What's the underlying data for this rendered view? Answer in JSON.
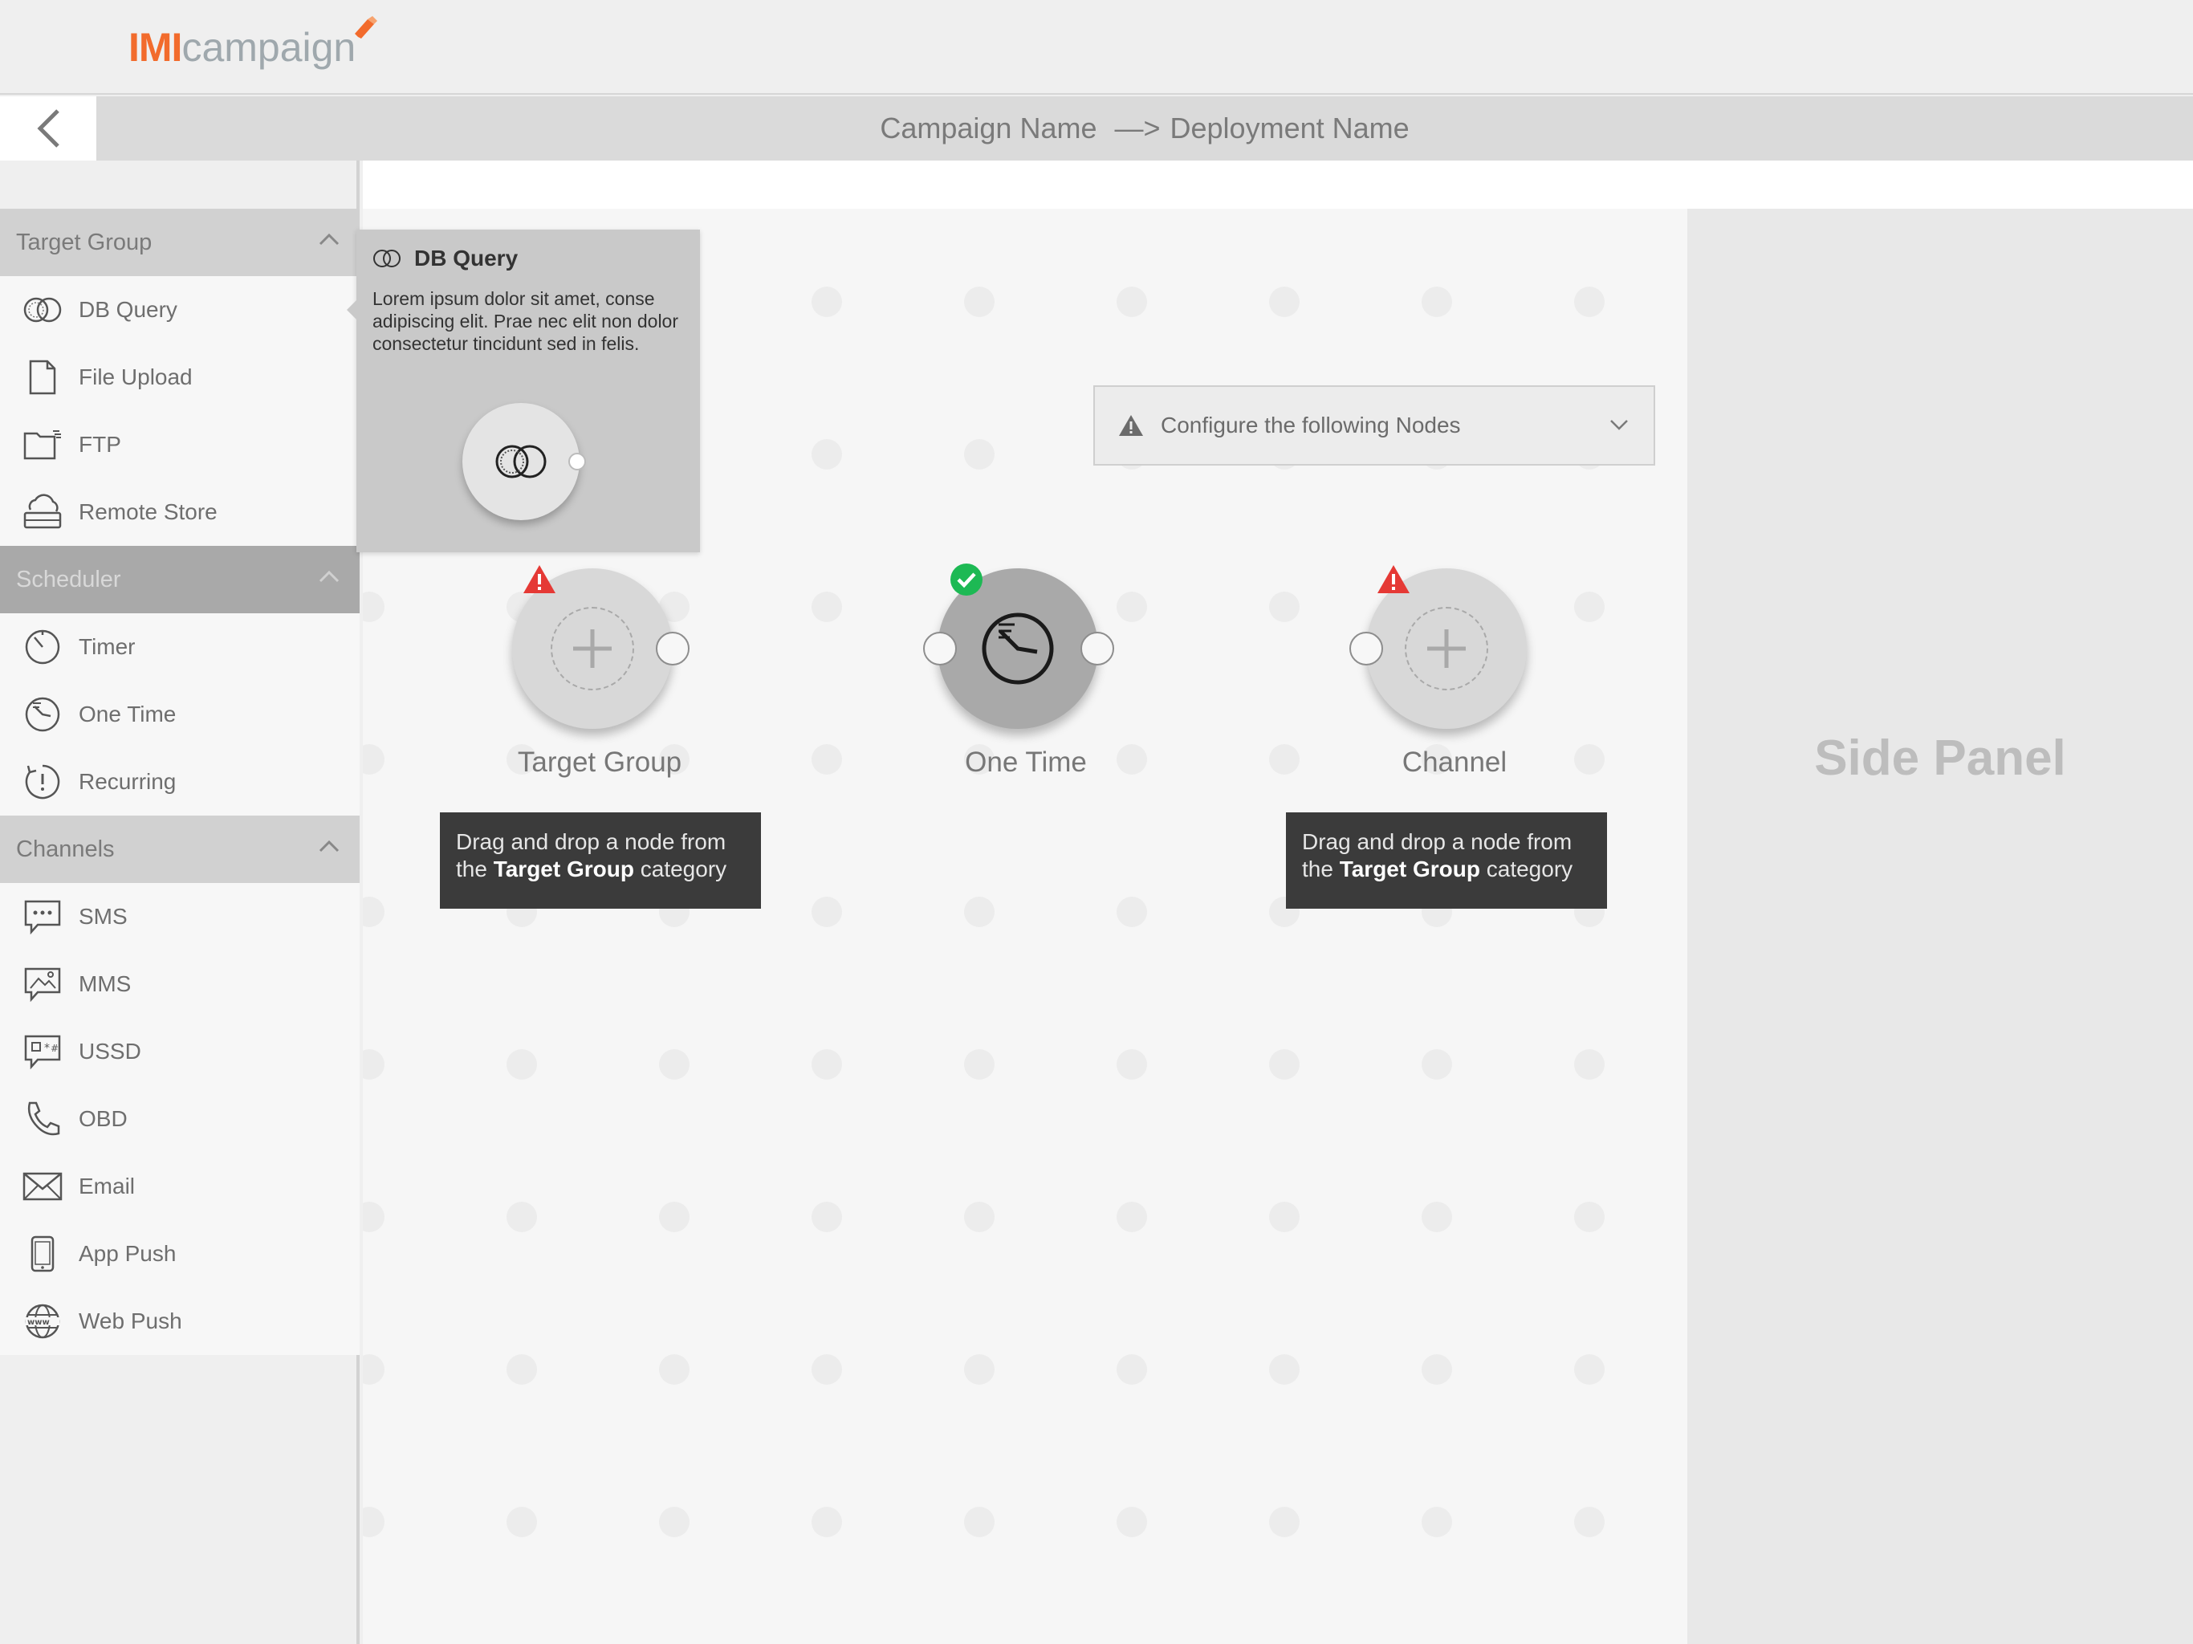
{
  "header": {
    "logo_primary": "IMI",
    "logo_secondary": "campaign"
  },
  "title_bar": {
    "campaign_name": "Campaign Name",
    "arrow": "—>",
    "deployment_name": "Deployment Name"
  },
  "sidebar": {
    "sections": [
      {
        "title": "Target Group",
        "items": [
          {
            "label": "DB Query",
            "icon": "db-query-icon"
          },
          {
            "label": "File Upload",
            "icon": "file-icon"
          },
          {
            "label": "FTP",
            "icon": "ftp-folder-icon"
          },
          {
            "label": "Remote Store",
            "icon": "cloud-storage-icon"
          }
        ]
      },
      {
        "title": "Scheduler",
        "items": [
          {
            "label": "Timer",
            "icon": "timer-icon"
          },
          {
            "label": "One Time",
            "icon": "one-time-clock-icon"
          },
          {
            "label": "Recurring",
            "icon": "recurring-icon"
          }
        ]
      },
      {
        "title": "Channels",
        "items": [
          {
            "label": "SMS",
            "icon": "sms-icon"
          },
          {
            "label": "MMS",
            "icon": "mms-icon"
          },
          {
            "label": "USSD",
            "icon": "ussd-icon"
          },
          {
            "label": "OBD",
            "icon": "phone-icon"
          },
          {
            "label": "Email",
            "icon": "email-icon"
          },
          {
            "label": "App Push",
            "icon": "mobile-icon"
          },
          {
            "label": "Web Push",
            "icon": "www-globe-icon"
          }
        ]
      }
    ]
  },
  "db_card": {
    "title": "DB Query",
    "description": "Lorem ipsum dolor sit amet, conse adipiscing elit. Prae nec elit non dolor consectetur tincidunt sed in felis."
  },
  "configure": {
    "label": "Configure the following Nodes"
  },
  "nodes": [
    {
      "label": "Target Group",
      "status": "warning"
    },
    {
      "label": "One Time",
      "status": "ok"
    },
    {
      "label": "Channel",
      "status": "warning"
    }
  ],
  "hints": [
    {
      "prefix": "Drag and drop a node from the ",
      "bold": "Target Group",
      "suffix": " category"
    },
    {
      "prefix": "Drag and drop a node from the ",
      "bold": "Target Group",
      "suffix": " category"
    }
  ],
  "side_panel": {
    "label": "Side Panel"
  },
  "colors": {
    "brand_orange": "#f26b2c",
    "warning_red": "#e53935",
    "success_green": "#1db954"
  }
}
